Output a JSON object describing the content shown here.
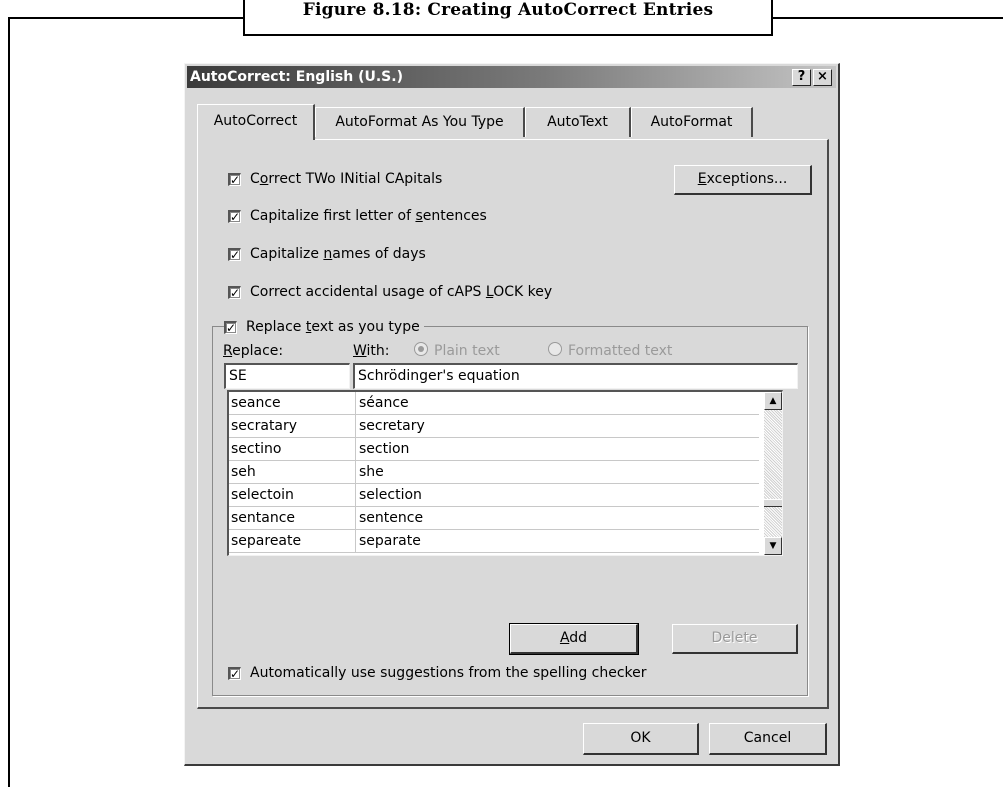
{
  "figure": {
    "caption": "Figure 8.18: Creating AutoCorrect Entries"
  },
  "dialog": {
    "title": "AutoCorrect: English (U.S.)",
    "help_label": "?",
    "close_label": "×",
    "tabs": [
      {
        "label": "AutoCorrect",
        "active": true
      },
      {
        "label": "AutoFormat As You Type",
        "active": false
      },
      {
        "label": "AutoText",
        "active": false
      },
      {
        "label": "AutoFormat",
        "active": false
      }
    ],
    "options": [
      {
        "label_pre": "C",
        "label_u": "o",
        "label_post": "rrect TWo INitial CApitals",
        "checked": true
      },
      {
        "label_pre": "Capitalize first letter of ",
        "label_u": "s",
        "label_post": "entences",
        "checked": true
      },
      {
        "label_pre": "Capitalize ",
        "label_u": "n",
        "label_post": "ames of days",
        "checked": true
      },
      {
        "label_pre": "Correct accidental usage of cAPS ",
        "label_u": "L",
        "label_post": "OCK key",
        "checked": true
      }
    ],
    "check_mark": "✓",
    "exceptions_button": {
      "label_u": "E",
      "label_post": "xceptions..."
    },
    "replace_group": {
      "checkbox": {
        "label_pre": "Replace ",
        "label_u": "t",
        "label_post": "ext as you type",
        "checked": true
      },
      "replace_label": {
        "label_u": "R",
        "label_post": "eplace:"
      },
      "with_label": {
        "label_u": "W",
        "label_post": "ith:"
      },
      "radio_plain": {
        "label": "Plain text",
        "selected": true,
        "enabled": false
      },
      "radio_formatted": {
        "label": "Formatted text",
        "selected": false,
        "enabled": false
      },
      "replace_value": "SE",
      "with_value": "Schrödinger's equation",
      "entries": [
        {
          "replace": "seance",
          "with": "séance"
        },
        {
          "replace": "secratary",
          "with": "secretary"
        },
        {
          "replace": "sectino",
          "with": "section"
        },
        {
          "replace": "seh",
          "with": "she"
        },
        {
          "replace": "selectoin",
          "with": "selection"
        },
        {
          "replace": "sentance",
          "with": "sentence"
        },
        {
          "replace": "separeate",
          "with": "separate"
        }
      ],
      "add_button": {
        "label_u": "A",
        "label_post": "dd"
      },
      "delete_button": {
        "label": "Delete",
        "enabled": false
      },
      "suggestions_checkbox": {
        "label_pre": "Automatically use su",
        "label_u": "g",
        "label_post": "gestions from the spelling checker",
        "checked": true
      }
    },
    "ok_label": "OK",
    "cancel_label": "Cancel"
  }
}
